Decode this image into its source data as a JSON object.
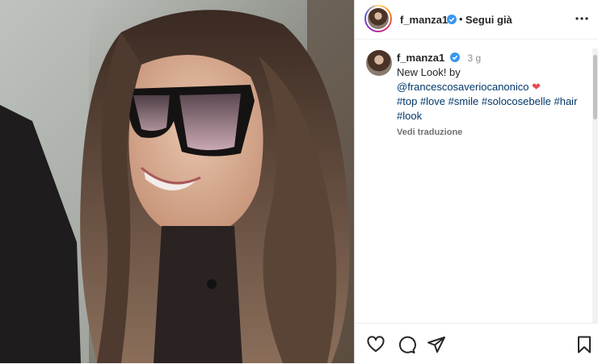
{
  "header": {
    "username": "f_manza1",
    "separator": "•",
    "follow_label": "Segui già",
    "more_icon": "more-horizontal-icon"
  },
  "caption": {
    "username": "f_manza1",
    "time": "3 g",
    "line1": "New Look! by",
    "mention": "@francescosaveriocanonico",
    "heart": "❤",
    "hashtags": [
      "#top",
      "#love",
      "#smile",
      "#solocosebelle",
      "#hair",
      "#look"
    ],
    "translate_label": "Vedi traduzione"
  },
  "actions": {
    "like_icon": "heart-icon",
    "comment_icon": "comment-icon",
    "share_icon": "send-icon",
    "save_icon": "bookmark-icon"
  },
  "colors": {
    "verified": "#3897f0",
    "link": "#00376b",
    "heart": "#ed4956"
  }
}
